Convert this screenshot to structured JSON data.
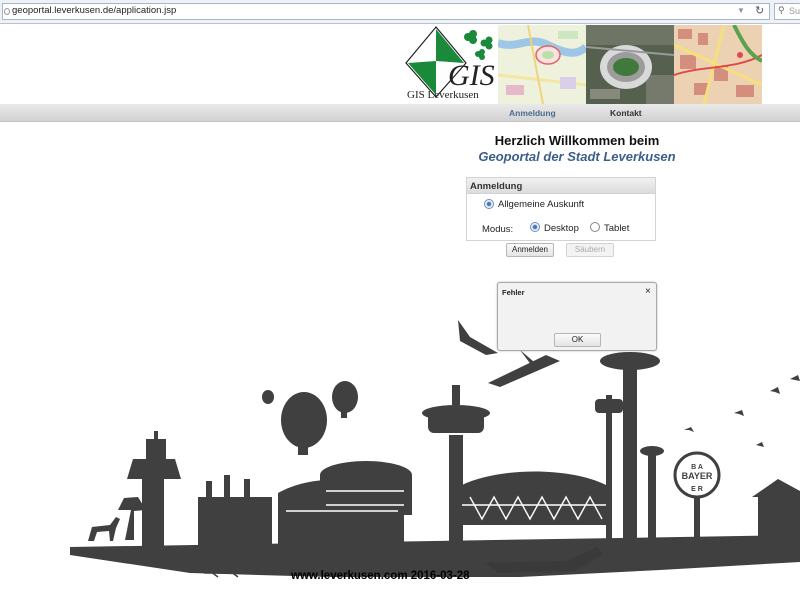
{
  "browser": {
    "url": "geoportal.leverkusen.de/application.jsp",
    "search_placeholder": "Suc"
  },
  "header": {
    "logo_text": "GIS",
    "logo_name": "GIS Leverkusen"
  },
  "nav": {
    "login": "Anmeldung",
    "contact": "Kontakt"
  },
  "welcome": {
    "line1": "Herzlich Willkommen beim",
    "line2": "Geoportal der Stadt Leverkusen"
  },
  "login_panel": {
    "title": "Anmeldung",
    "option_general": "Allgemeine Auskunft",
    "mode_label": "Modus:",
    "mode_desktop": "Desktop",
    "mode_tablet": "Tablet",
    "selected_mode": "Desktop"
  },
  "buttons": {
    "login": "Anmelden",
    "clear": "Säubern"
  },
  "dialog": {
    "title": "Fehler",
    "close": "×",
    "ok": "OK"
  },
  "footer": {
    "text": "www.leverkusen.com  2016-03-28"
  },
  "colors": {
    "accent_blue": "#3b5f8a",
    "nav_link": "#4b6c8e",
    "skyline": "#404040",
    "logo_green": "#1a8a3a"
  }
}
